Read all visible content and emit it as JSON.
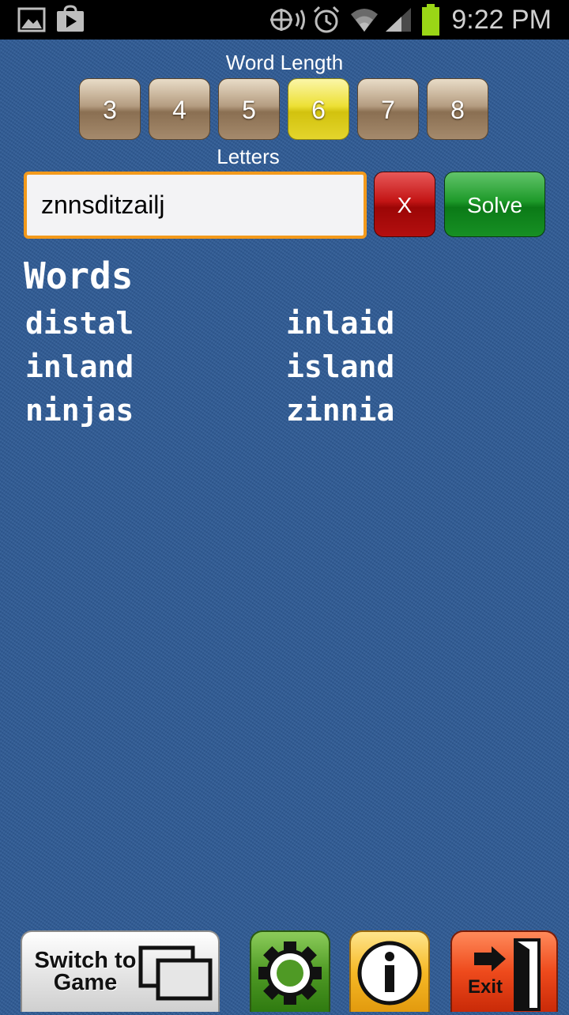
{
  "status_bar": {
    "time": "9:22 PM",
    "icons": [
      "gallery-icon",
      "play-store-icon",
      "gps-icon",
      "alarm-icon",
      "wifi-icon",
      "signal-icon",
      "battery-icon"
    ],
    "battery_color": "#9ad616"
  },
  "word_length": {
    "label": "Word Length",
    "options": [
      "3",
      "4",
      "5",
      "6",
      "7",
      "8"
    ],
    "selected": "6"
  },
  "letters": {
    "label": "Letters",
    "value": "znnsditzailj"
  },
  "buttons": {
    "clear": "X",
    "solve": "Solve"
  },
  "words": {
    "title": "Words",
    "list": [
      "distal",
      "inlaid",
      "inland",
      "island",
      "ninjas",
      "zinnia"
    ]
  },
  "bottom_bar": {
    "switch_line1": "Switch to",
    "switch_line2": "Game",
    "exit": "Exit",
    "icons": [
      "windows-icon",
      "gear-icon",
      "info-icon",
      "exit-door-icon"
    ]
  },
  "colors": {
    "background": "#2f5b95",
    "selected_length": "#ede035",
    "clear_button": "#c31515",
    "solve_button": "#1e9a2a",
    "input_border": "#f39a1c"
  }
}
